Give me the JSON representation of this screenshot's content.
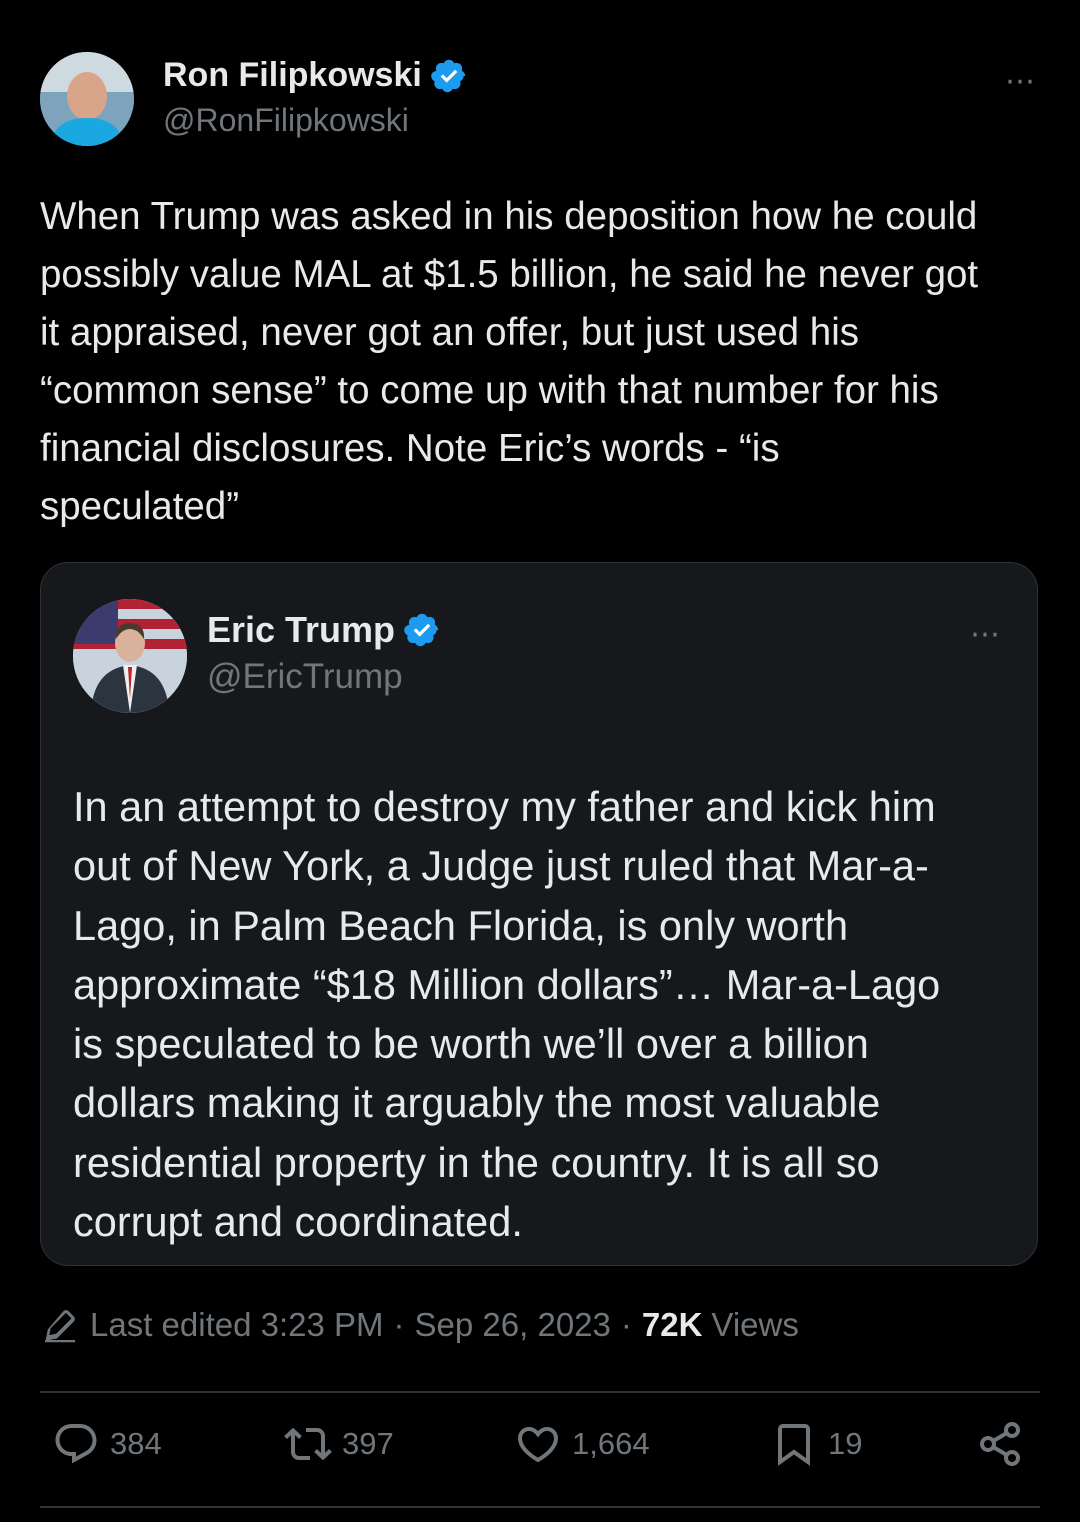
{
  "tweet": {
    "author": {
      "name": "Ron Filipkowski",
      "handle": "@RonFilipkowski",
      "avatar": "avatar-photo"
    },
    "more_icon": "⋯",
    "lines": [
      "When Trump was asked in his deposition how he could",
      "possibly value MAL at $1.5 billion, he said he never got",
      "it appraised, never got an offer, but just used his",
      "“common sense” to come up with that number for his",
      "financial disclosures. Note Eric’s words - “is",
      "speculated”"
    ]
  },
  "quote": {
    "author": {
      "name": "Eric Trump",
      "handle": "@EricTrump",
      "avatar": "avatar-photo"
    },
    "more_icon": "⋯",
    "lines": [
      "In an attempt to destroy my father and kick him",
      "out of New York, a Judge just ruled that Mar-a-",
      "Lago, in Palm Beach Florida, is only worth",
      "approximate “$18 Million dollars”… Mar-a-Lago",
      "is speculated to be worth we’ll over a billion",
      "dollars making it arguably the most valuable",
      "residential property in the country. It is all so",
      "corrupt and coordinated."
    ]
  },
  "meta": {
    "edited": "Last edited 3:23 PM",
    "sep1": "·",
    "date": "Sep 26, 2023",
    "sep2": "·",
    "views_count": "72K",
    "views_label": "Views"
  },
  "actions": {
    "replies": "384",
    "reposts": "397",
    "likes": "1,664",
    "bookmarks": "19"
  },
  "colors": {
    "background": "#000000",
    "text": "#e7e9ea",
    "muted": "#71767b",
    "verified": "#1d9bf0",
    "quote_bg": "#16181c"
  }
}
